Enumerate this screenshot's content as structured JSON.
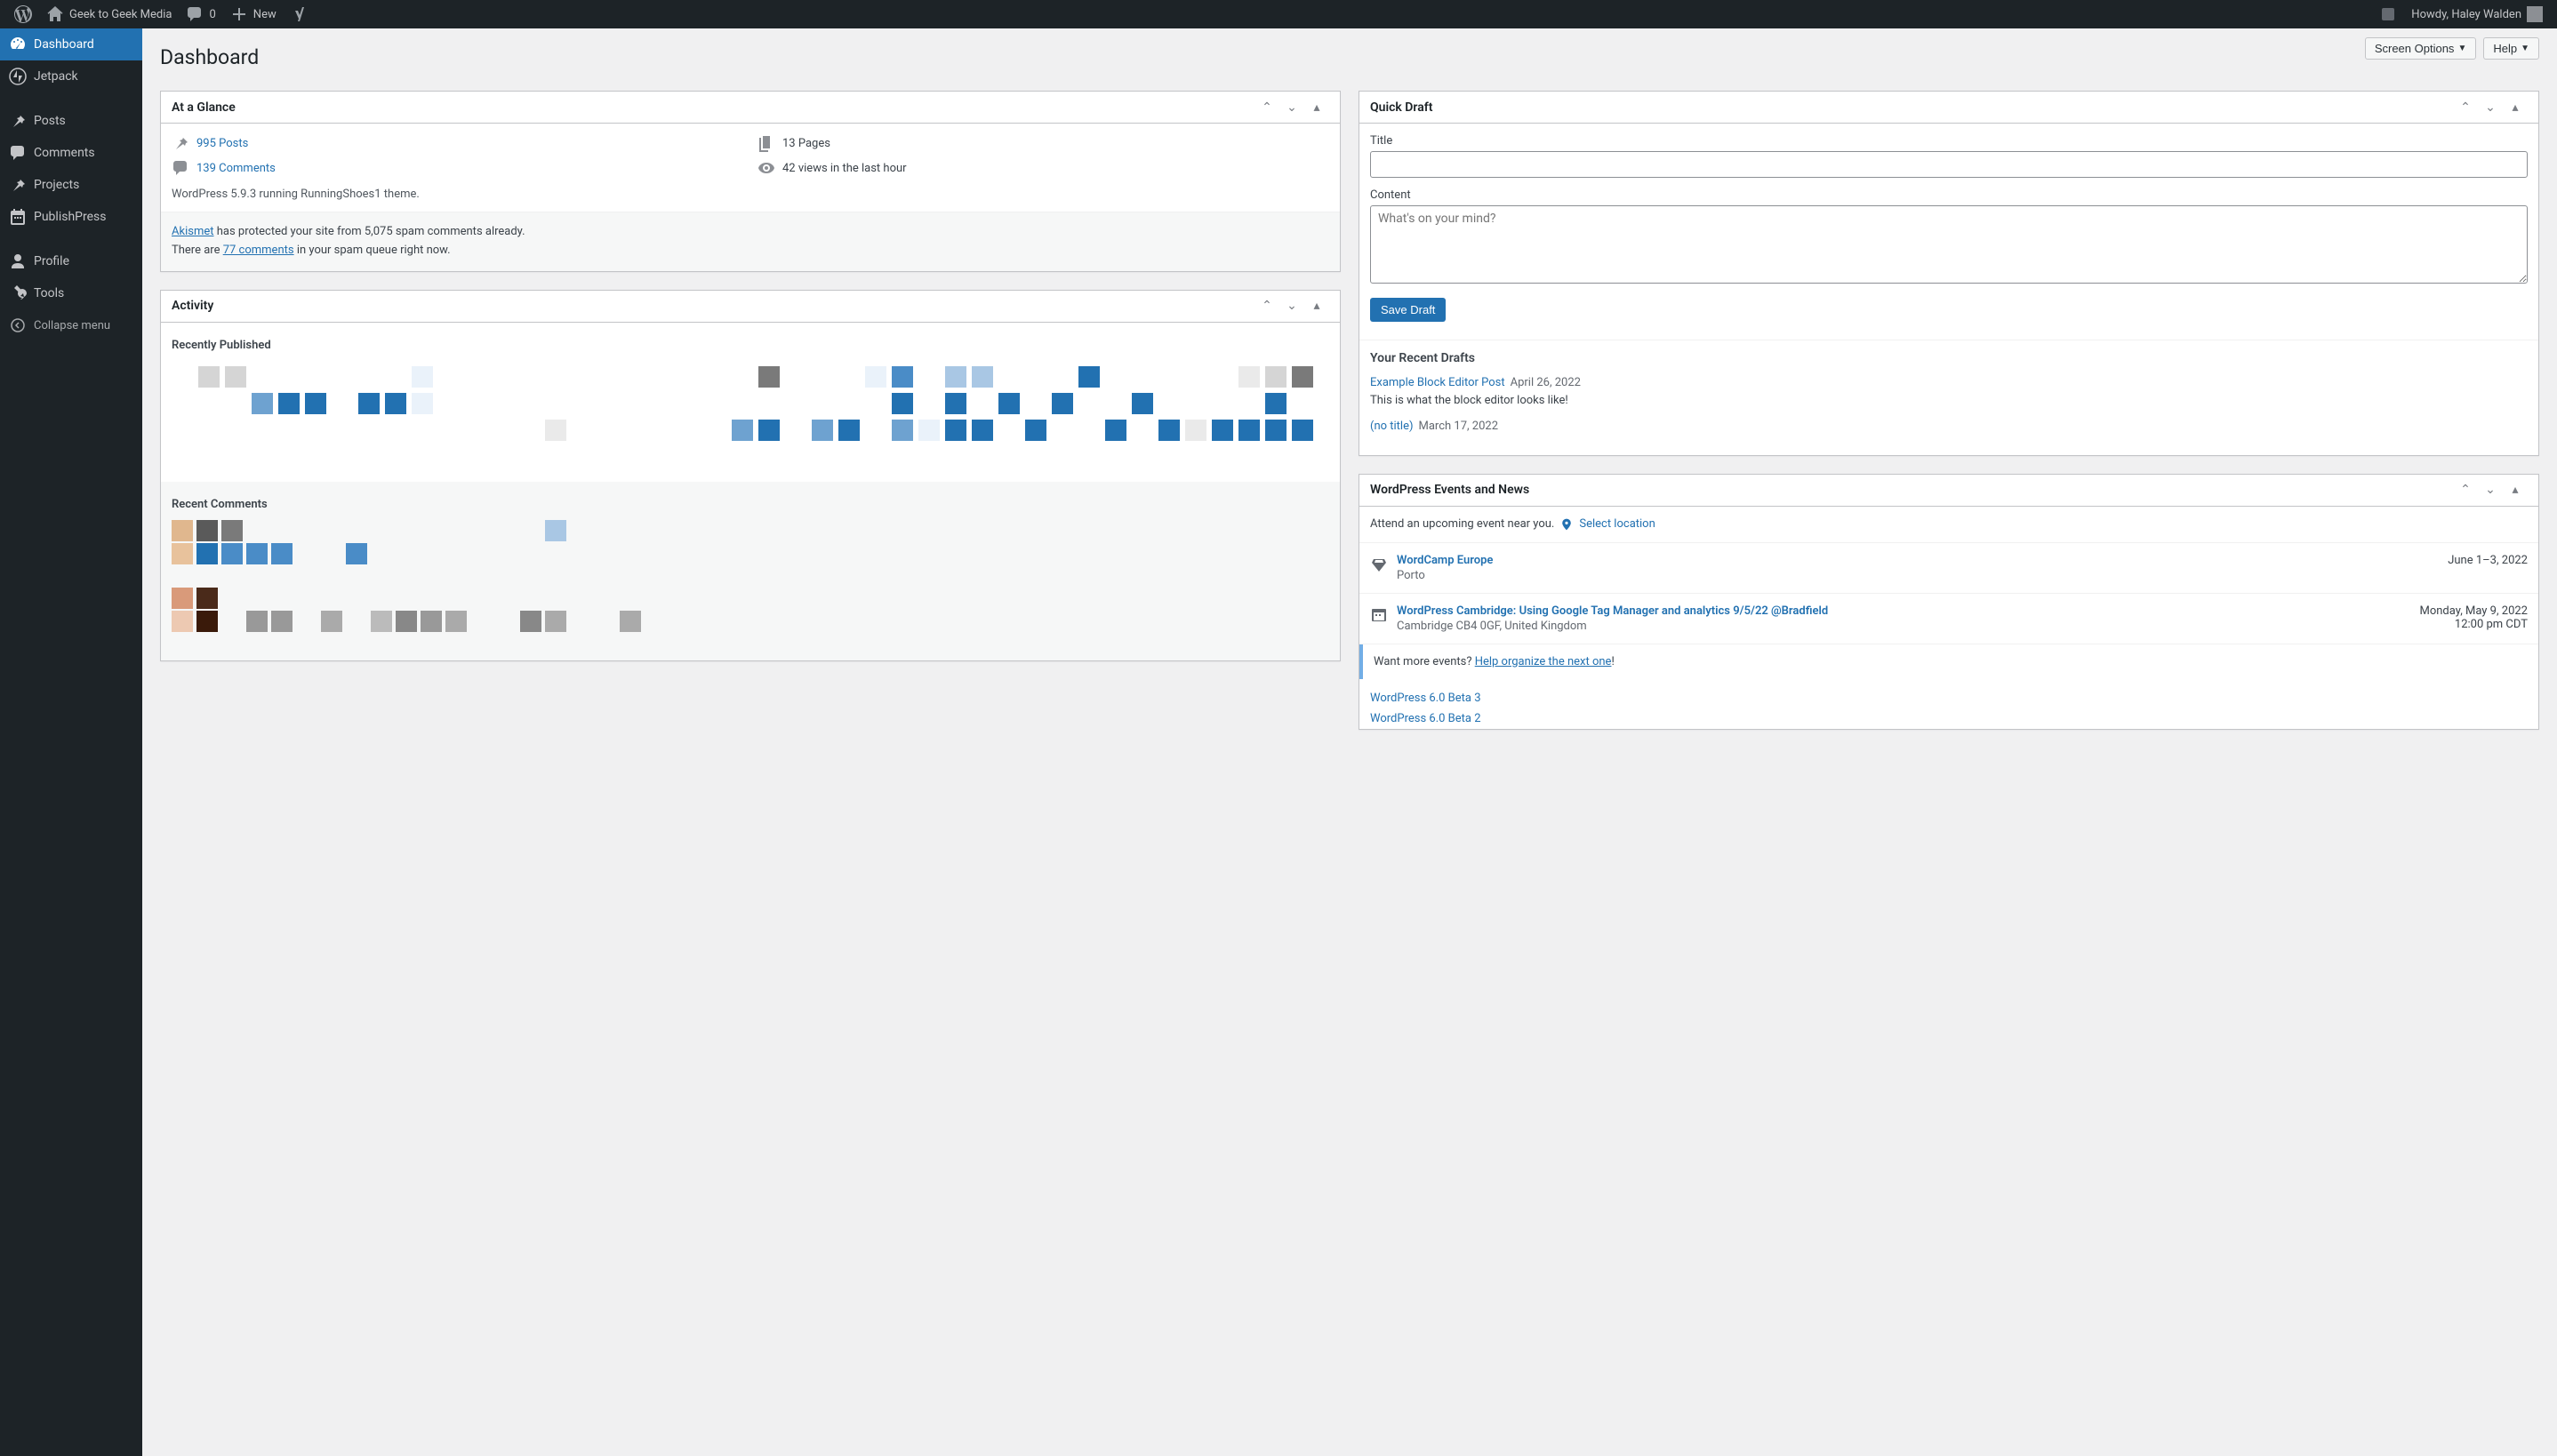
{
  "adminbar": {
    "site_name": "Geek to Geek Media",
    "comments_count": "0",
    "new_label": "New",
    "howdy": "Howdy, Haley Walden"
  },
  "sidebar": {
    "items": [
      {
        "label": "Dashboard",
        "icon": "dashboard",
        "current": true
      },
      {
        "label": "Jetpack",
        "icon": "jetpack"
      },
      {
        "label": "Posts",
        "icon": "pin"
      },
      {
        "label": "Comments",
        "icon": "chat"
      },
      {
        "label": "Projects",
        "icon": "pin"
      },
      {
        "label": "PublishPress",
        "icon": "calendar"
      },
      {
        "label": "Profile",
        "icon": "user"
      },
      {
        "label": "Tools",
        "icon": "wrench"
      }
    ],
    "collapse": "Collapse menu"
  },
  "header": {
    "title": "Dashboard",
    "screen_options": "Screen Options",
    "help": "Help"
  },
  "glance": {
    "title": "At a Glance",
    "posts": "995 Posts",
    "pages": "13 Pages",
    "comments": "139 Comments",
    "views": "42 views in the last hour",
    "version": "WordPress 5.9.3 running RunningShoes1 theme.",
    "akismet_link": "Akismet",
    "akismet_text": " has protected your site from 5,075 spam comments already.",
    "spam_pre": "There are ",
    "spam_link": "77 comments",
    "spam_post": " in your spam queue right now."
  },
  "activity": {
    "title": "Activity",
    "recently_published": "Recently Published",
    "recent_comments": "Recent Comments"
  },
  "quickdraft": {
    "title": "Quick Draft",
    "title_label": "Title",
    "content_label": "Content",
    "content_placeholder": "What's on your mind?",
    "save_button": "Save Draft",
    "recent_heading": "Your Recent Drafts",
    "drafts": [
      {
        "title": "Example Block Editor Post",
        "date": "April 26, 2022",
        "excerpt": "This is what the block editor looks like!"
      },
      {
        "title": "(no title)",
        "date": "March 17, 2022",
        "excerpt": ""
      }
    ]
  },
  "events": {
    "title": "WordPress Events and News",
    "attend_text": "Attend an upcoming event near you.",
    "select_location": "Select location",
    "items": [
      {
        "title": "WordCamp Europe",
        "location": "Porto",
        "date": "June 1–3, 2022",
        "time": "",
        "icon": "wordcamp"
      },
      {
        "title": "WordPress Cambridge: Using Google Tag Manager and analytics 9/5/22 @Bradfield",
        "location": "Cambridge CB4 0GF, United Kingdom",
        "date": "Monday, May 9, 2022",
        "time": "12:00 pm CDT",
        "icon": "meetup"
      }
    ],
    "more_pre": "Want more events? ",
    "more_link": "Help organize the next one",
    "more_post": "!",
    "news": [
      "WordPress 6.0 Beta 3",
      "WordPress 6.0 Beta 2"
    ]
  }
}
